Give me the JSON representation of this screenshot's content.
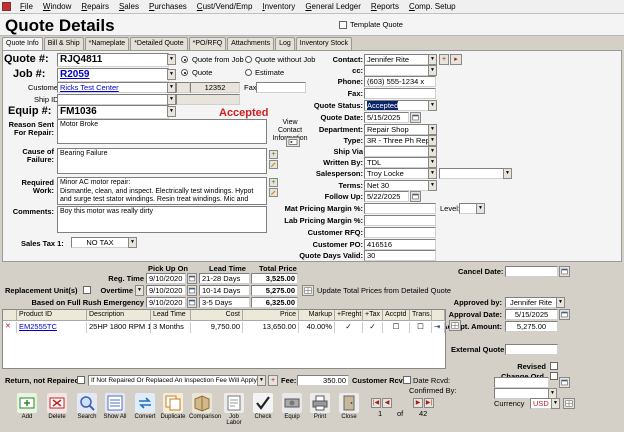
{
  "menu": [
    "File",
    "Window",
    "Repairs",
    "Sales",
    "Purchases",
    "Cust/Vend/Emp",
    "Inventory",
    "General Ledger",
    "Reports",
    "Comp. Setup"
  ],
  "page_title": "Quote Details",
  "template_quote_label": "Template Quote",
  "tabs": [
    "Quote Info",
    "Bill & Ship",
    "*Nameplate",
    "*Detailed Quote",
    "*PO/RFQ",
    "Attachments",
    "Log",
    "Inventory Stock"
  ],
  "left": {
    "quote_label": "Quote #:",
    "quote": "RJQ4811",
    "job_label": "Job #:",
    "job": "R2059",
    "customer_label": "Customer",
    "customer": "Ricks Test Center",
    "ship_id_label": "Ship ID",
    "equip_label": "Equip #:",
    "equip": "FM1036",
    "reason_label": "Reason Sent For Repair:",
    "reason": "Motor Broke",
    "cause_label": "Cause of Failure:",
    "cause": "Bearing Failure",
    "required_label": "Required Work:",
    "required": "Minor AC motor repair:\nDismantle, clean, and inspect.  Electrically test windings.  Hypot and surge test stator windings.  Resin treat windings.  Mic and record all mechanical fits.  Dynamically balance all rotating parts.  Install new",
    "comments_label": "Comments:",
    "comments": "Boy this motor was really dirty",
    "view_contact": "View Contact Information",
    "sales_tax_label": "Sales Tax 1:",
    "sales_tax": "NO TAX"
  },
  "mid": {
    "quote_from_job": "Quote from Job",
    "quote_without_job": "Quote without Job",
    "quote": "Quote",
    "estimate": "Estimate",
    "job_num": "12352",
    "fax_label": "Fax",
    "status_text": "Accepted"
  },
  "right": {
    "contact_label": "Contact:",
    "contact": "Jennifer Rite",
    "cc_label": "cc:",
    "phone_label": "Phone:",
    "phone": "(603) 555-1234 x",
    "fax_label": "Fax:",
    "status_label": "Quote Status:",
    "status": "Accepted",
    "date_label": "Quote Date:",
    "date": "5/15/2025",
    "dept_label": "Department:",
    "dept": "Repair Shop",
    "type_label": "Type:",
    "type": "3R - Three Ph Repair",
    "shipvia_label": "Ship Via",
    "writtenby_label": "Written By:",
    "writtenby": "TDL",
    "salesperson_label": "Salesperson:",
    "salesperson": "Troy Locke",
    "terms_label": "Terms:",
    "terms": "Net 30",
    "followup_label": "Follow Up:",
    "followup": "5/22/2025",
    "mat_margin_label": "Mat Pricing Margin %:",
    "level_label": "Level:",
    "lab_margin_label": "Lab Pricing Margin %:",
    "rfq_label": "Customer RFQ:",
    "po_label": "Customer PO:",
    "po": "416516",
    "valid_label": "Quote Days Valid:",
    "valid": "30"
  },
  "pricing": {
    "headers": [
      "Pick Up On",
      "Lead Time",
      "Total Price"
    ],
    "reg_label": "Reg. Time",
    "reg_date": "9/10/2020",
    "reg_lead": "21-28 Days",
    "reg_price": "3,525.00",
    "repl_label": "Replacement Unit(s)",
    "overtime_label": "Overtime",
    "ot_date": "9/10/2020",
    "ot_lead": "10-14 Days",
    "ot_price": "5,275.00",
    "rush_label": "Based on Full Rush Emergency",
    "rush_date": "9/10/2020",
    "rush_lead": "3-5 Days",
    "rush_price": "6,325.00",
    "update_label": "Update Total Prices from Detailed Quote"
  },
  "side": {
    "cancel_label": "Cancel Date:",
    "approved_by_label": "Approved by:",
    "approved_by": "Jennifer Rite",
    "approval_date_label": "Approval Date:",
    "approval_date": "5/15/2025",
    "accpt_label": "Accept. Amount:",
    "accpt": "5,275.00",
    "external_label": "External Quote:",
    "revised_label": "Revised",
    "change_label": "Change Ord.",
    "confirmed_label": "Confirmed By:",
    "currency_label": "Currency",
    "currency": "USD"
  },
  "table": {
    "headers": [
      "Product ID",
      "Description",
      "Lead Time",
      "Cost",
      "Price",
      "Markup",
      "+Freght",
      "+Tax",
      "Accptd",
      "Trans."
    ],
    "rows": [
      {
        "product": "EM2555TC",
        "desc": "25HP 1800 RPM 1",
        "lead": "3 Months",
        "cost": "9,750.00",
        "price": "13,650.00",
        "markup": "40.00%"
      }
    ]
  },
  "bottom": {
    "return_label": "Return, not Repaired",
    "return_value": "If Not Repaired Or Replaced An Inspection Fee Will Apply",
    "fee_label": "Fee:",
    "fee": "350.00",
    "rcvd_label": "Customer Rcvd:",
    "date_rcvd_label": "Date Rcvd:",
    "nav_current": "1",
    "nav_of": "of",
    "nav_total": "42"
  },
  "toolbar": [
    {
      "label": "Add",
      "icon": "add-icon",
      "color": "#2a8a2a"
    },
    {
      "label": "Delete",
      "icon": "delete-icon",
      "color": "#c02020"
    },
    {
      "label": "Search",
      "icon": "search-icon",
      "color": "#4060b0"
    },
    {
      "label": "Show All",
      "icon": "show-all-icon",
      "color": "#5070c0"
    },
    {
      "label": "Convert",
      "icon": "convert-icon",
      "color": "#2070c0"
    },
    {
      "label": "Duplicate",
      "icon": "duplicate-icon",
      "color": "#c08020"
    },
    {
      "label": "Comparison",
      "icon": "comparison-icon",
      "color": "#8a7040"
    },
    {
      "label": "Job Labor",
      "icon": "job-labor-icon",
      "color": "#a0a0a0"
    },
    {
      "label": "Check",
      "icon": "check-icon",
      "color": "#222222"
    },
    {
      "label": "Equip",
      "icon": "equip-icon",
      "color": "#707070"
    },
    {
      "label": "Print",
      "icon": "print-icon",
      "color": "#606060"
    },
    {
      "label": "Close",
      "icon": "close-icon",
      "color": "#808080"
    }
  ]
}
